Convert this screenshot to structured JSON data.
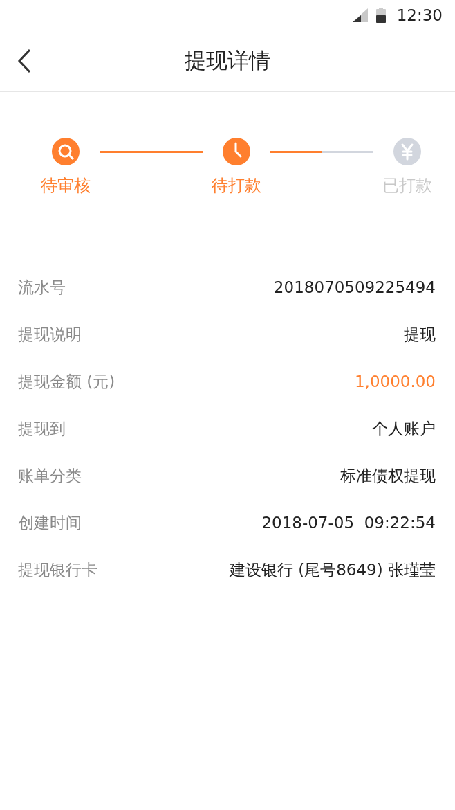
{
  "status_bar": {
    "time": "12:30"
  },
  "header": {
    "title": "提现详情"
  },
  "steps": [
    {
      "label": "待审核",
      "done": true,
      "kind": "search"
    },
    {
      "label": "待打款",
      "done": true,
      "kind": "clock"
    },
    {
      "label": "已打款",
      "done": false,
      "kind": "yen"
    }
  ],
  "connectors": [
    {
      "level": 1
    },
    {
      "level": 0.5
    }
  ],
  "details": [
    {
      "label": "流水号",
      "value": "2018070509225494",
      "highlight": false
    },
    {
      "label": "提现说明",
      "value": "提现",
      "highlight": false
    },
    {
      "label": "提现金额 (元)",
      "value": "1,0000.00",
      "highlight": true
    },
    {
      "label": "提现到",
      "value": "个人账户",
      "highlight": false
    },
    {
      "label": "账单分类",
      "value": "标准债权提现",
      "highlight": false
    },
    {
      "label": "创建时间",
      "value": "2018-07-05  09:22:54",
      "highlight": false
    },
    {
      "label": "提现银行卡",
      "value": "建设银行 (尾号8649) 张瑾莹",
      "highlight": false
    }
  ]
}
